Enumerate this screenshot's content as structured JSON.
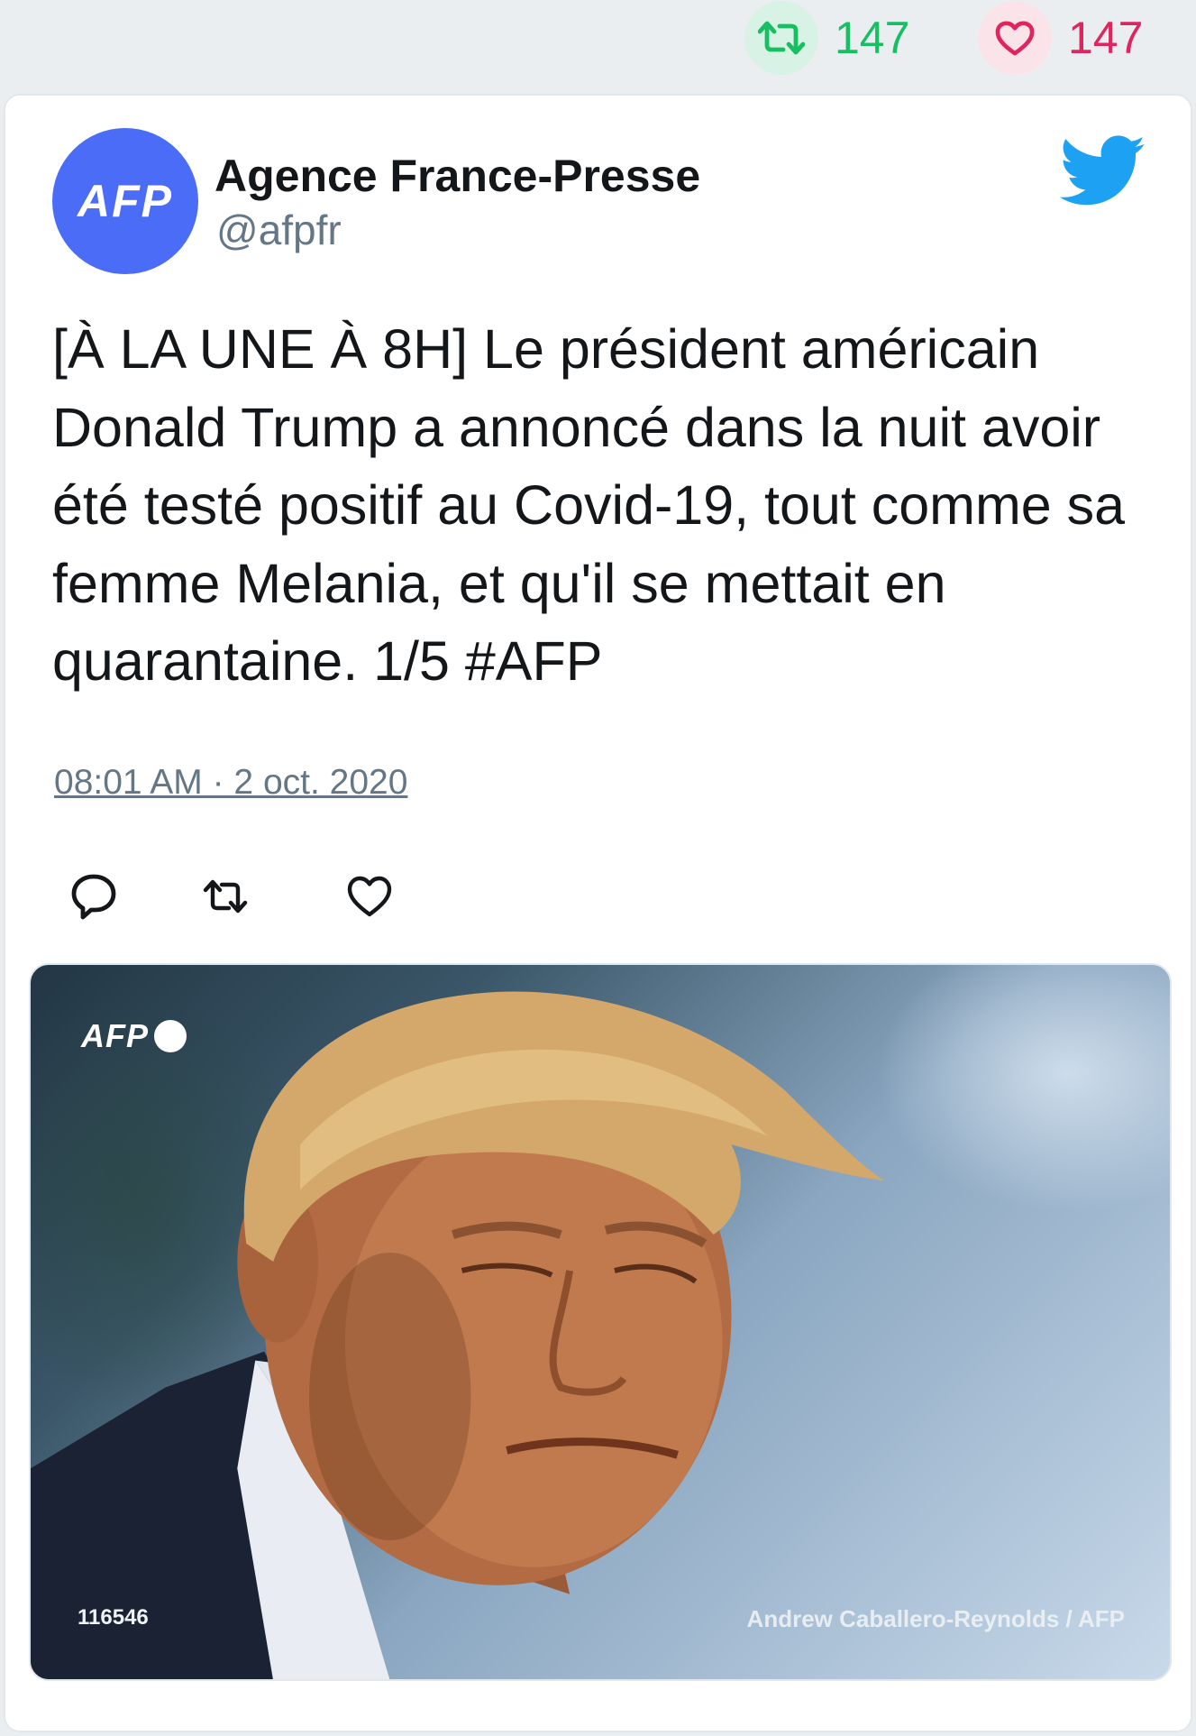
{
  "stats": {
    "retweet_count": "147",
    "like_count": "147",
    "retweet_color": "#17bf63",
    "like_color": "#e0245e"
  },
  "tweet": {
    "avatar_text": "AFP",
    "avatar_color": "#4a6cf7",
    "author_name": "Agence France-Presse",
    "author_handle": "@afpfr",
    "text": "[À LA UNE À 8H] Le président américain Donald Trump a annoncé dans la nuit avoir été testé positif au Covid-19, tout comme sa femme Melania, et qu'il se mettait en quarantaine. 1/5 #AFP",
    "timestamp": "08:01 AM · 2 oct. 2020",
    "brand_icon": "twitter-bird-icon",
    "brand_color": "#1da1f2",
    "actions": [
      "reply-icon",
      "retweet-icon",
      "like-icon"
    ]
  },
  "media": {
    "watermark_logo": "AFP",
    "photo_id": "116546",
    "credit": "Andrew Caballero-Reynolds / AFP"
  }
}
